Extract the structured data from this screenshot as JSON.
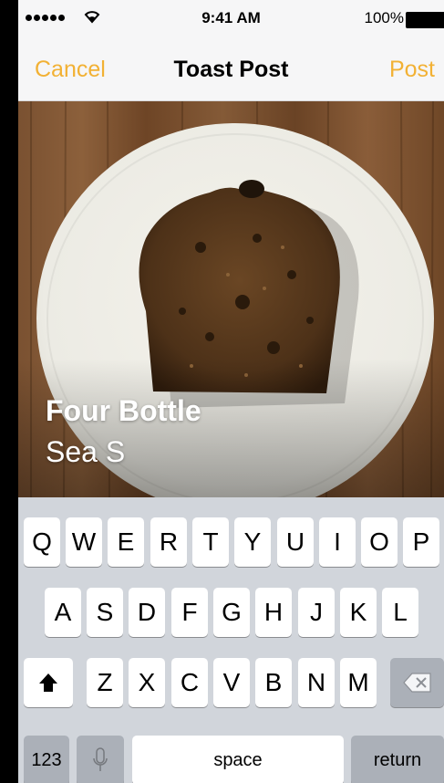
{
  "status": {
    "time": "9:41 AM",
    "battery": "100%"
  },
  "nav": {
    "cancel": "Cancel",
    "title": "Toast Post",
    "post": "Post"
  },
  "photo": {
    "title": "Four Bottle",
    "subtitle": "Sea S"
  },
  "keyboard": {
    "row1": [
      "Q",
      "W",
      "E",
      "R",
      "T",
      "Y",
      "U",
      "I",
      "O",
      "P"
    ],
    "row2": [
      "A",
      "S",
      "D",
      "F",
      "G",
      "H",
      "J",
      "K",
      "L"
    ],
    "row3": [
      "Z",
      "X",
      "C",
      "V",
      "B",
      "N",
      "M"
    ],
    "numbers": "123",
    "space": "space",
    "return": "return"
  },
  "colors": {
    "accent": "#f2b134"
  }
}
